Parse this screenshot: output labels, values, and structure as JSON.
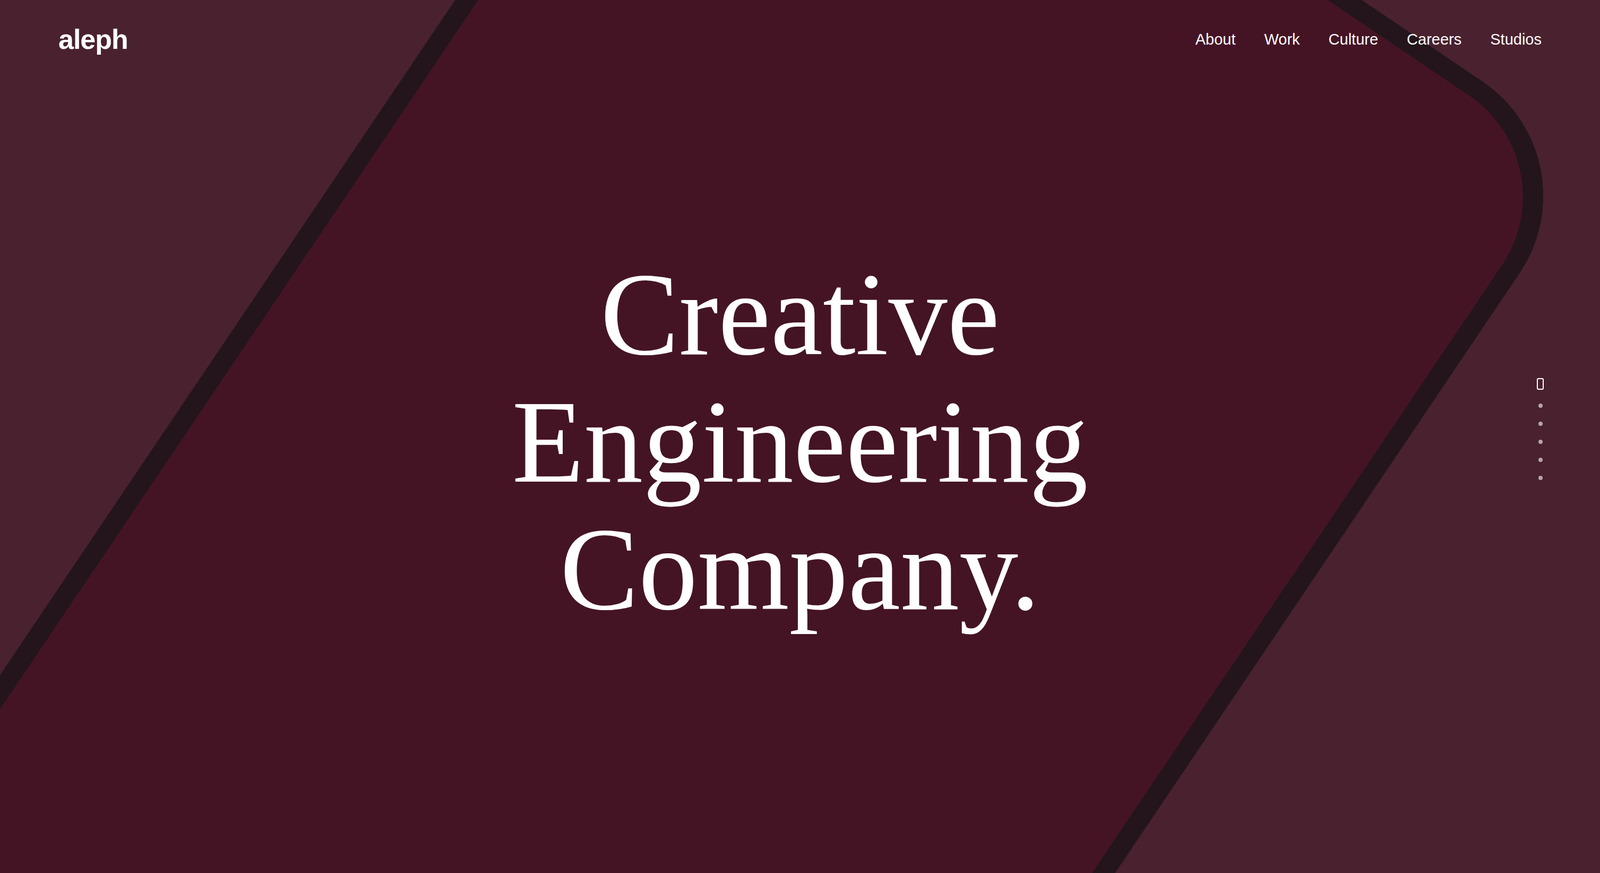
{
  "logo": "aleph",
  "nav": [
    {
      "label": "About"
    },
    {
      "label": "Work"
    },
    {
      "label": "Culture"
    },
    {
      "label": "Careers"
    },
    {
      "label": "Studios"
    }
  ],
  "headline": [
    "Creative",
    "Engineering",
    "Company."
  ],
  "pagination": [
    {
      "selected": true
    },
    {
      "selected": false
    },
    {
      "selected": false
    },
    {
      "selected": false
    },
    {
      "selected": false
    },
    {
      "selected": false
    }
  ]
}
